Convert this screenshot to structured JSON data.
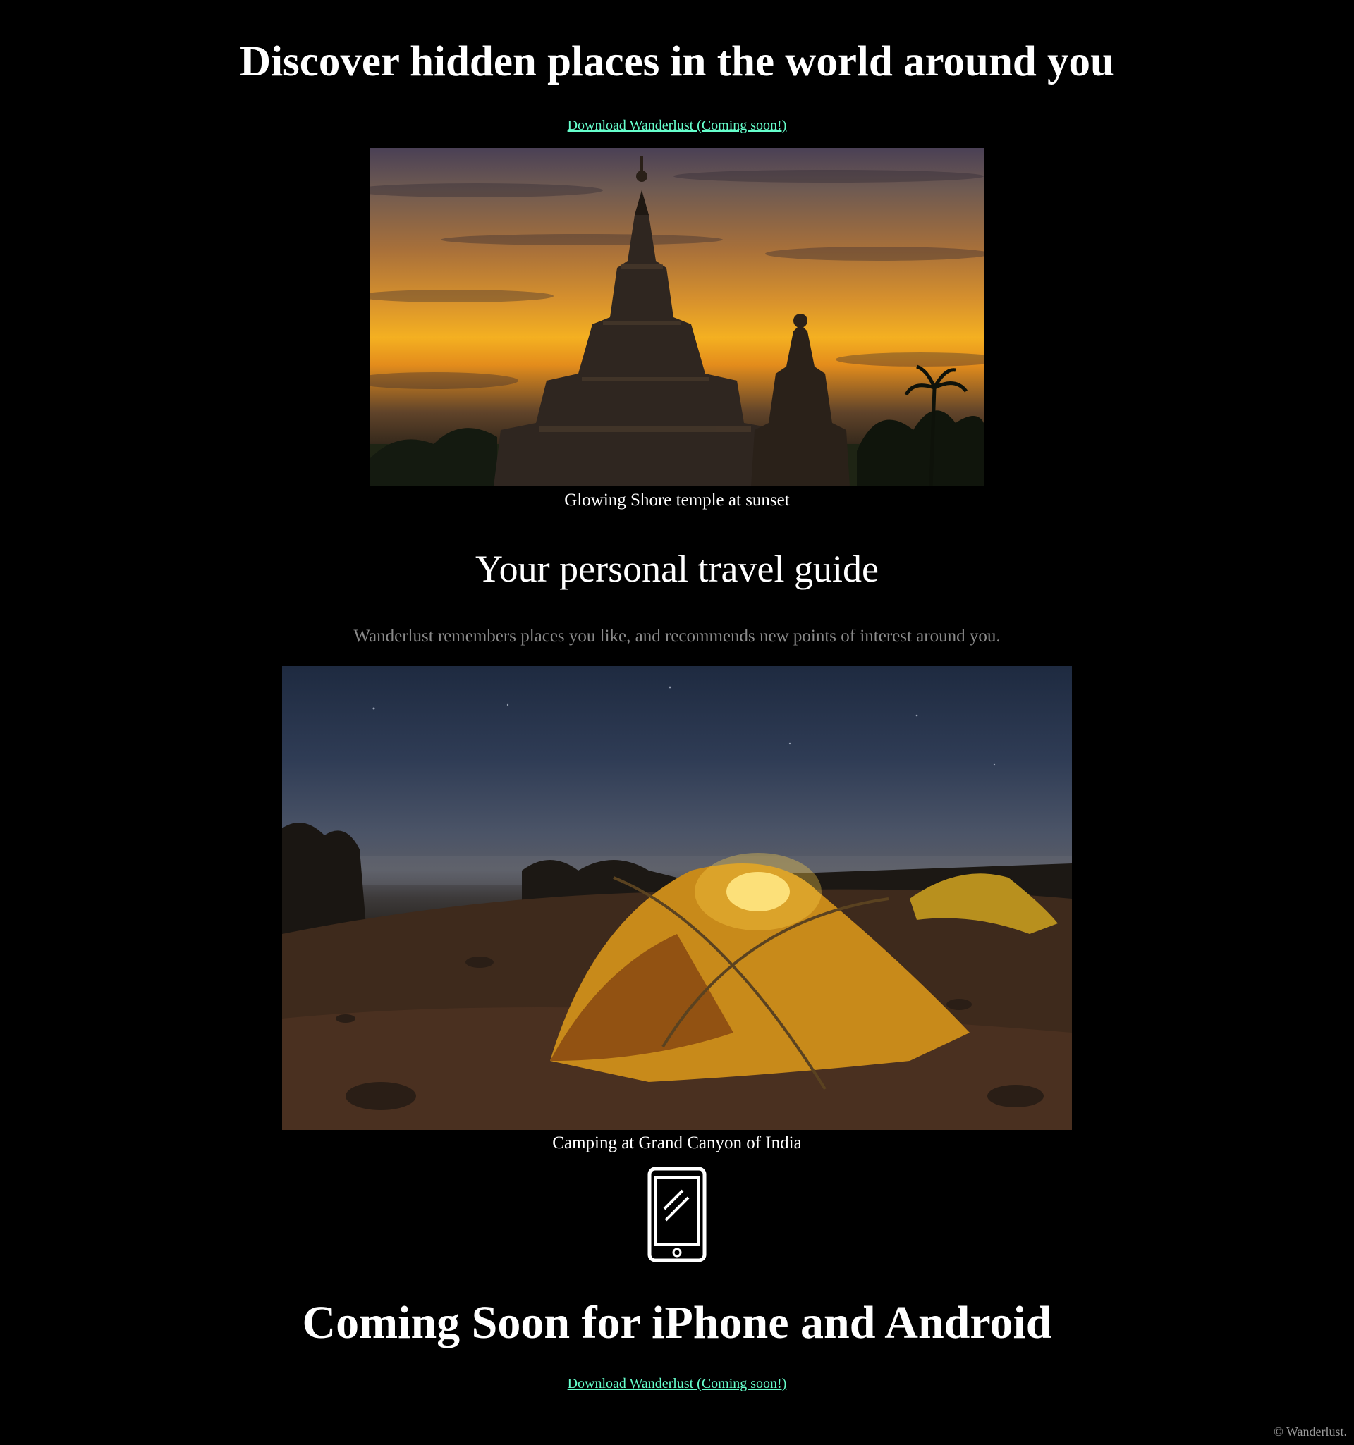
{
  "hero": {
    "title": "Discover hidden places in the world around you",
    "download_link": "Download Wanderlust (Coming soon!)"
  },
  "images": [
    {
      "caption": "Glowing Shore temple at sunset"
    },
    {
      "caption": "Camping at Grand Canyon of India"
    }
  ],
  "guide": {
    "title": "Your personal travel guide",
    "description": "Wanderlust remembers places you like, and recommends new points of interest around you."
  },
  "coming_soon": {
    "icon": "smartphone-icon",
    "title": "Coming Soon for iPhone and Android",
    "download_link": "Download Wanderlust (Coming soon!)"
  },
  "footer": {
    "copyright": "© Wanderlust."
  },
  "colors": {
    "background": "#000000",
    "text": "#ffffff",
    "link": "#66ffcc",
    "muted": "#8a8a8a"
  }
}
